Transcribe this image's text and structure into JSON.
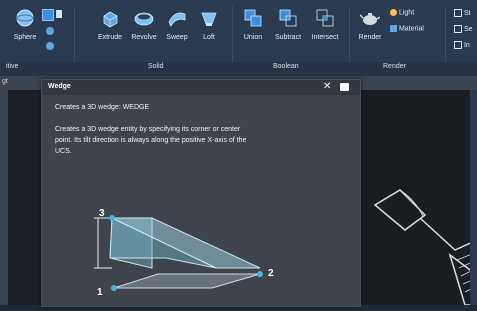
{
  "ribbon": {
    "modeling_tools": [
      {
        "label": "Sphere",
        "icon": "sphere-icon"
      },
      {
        "label": "Extrude",
        "icon": "extrude-icon"
      },
      {
        "label": "Revolve",
        "icon": "revolve-icon"
      },
      {
        "label": "Sweep",
        "icon": "sweep-icon"
      },
      {
        "label": "Loft",
        "icon": "loft-icon"
      }
    ],
    "boolean_tools": [
      {
        "label": "Union",
        "icon": "union-icon"
      },
      {
        "label": "Subtract",
        "icon": "subtract-icon"
      },
      {
        "label": "Intersect",
        "icon": "intersect-icon"
      }
    ],
    "render_tools": [
      {
        "label": "Render",
        "icon": "render-teapot-icon"
      },
      {
        "label": "Light",
        "icon": "light-bulb-icon"
      },
      {
        "label": "Material",
        "icon": "material-icon"
      }
    ],
    "right_partial": [
      "St",
      "Se",
      "In"
    ],
    "groups": {
      "primitive_partial": "itive",
      "solid": "Solid",
      "boolean": "Boolean",
      "render": "Render"
    },
    "accent": "#3a8ee6"
  },
  "pane_tab_partial": "gt",
  "tooltip": {
    "title": "Wedge",
    "summary": "Creates a 3D wedge: WEDGE",
    "description_lines": [
      "Creates a 3D wedge entity by specifying its corner or center",
      "point. Its tilt direction is always along the positive X-axis of the",
      "UCS."
    ],
    "close_icon": "close-icon",
    "pin_icon": "pin-icon",
    "callouts": [
      "3",
      "2",
      "1"
    ]
  }
}
